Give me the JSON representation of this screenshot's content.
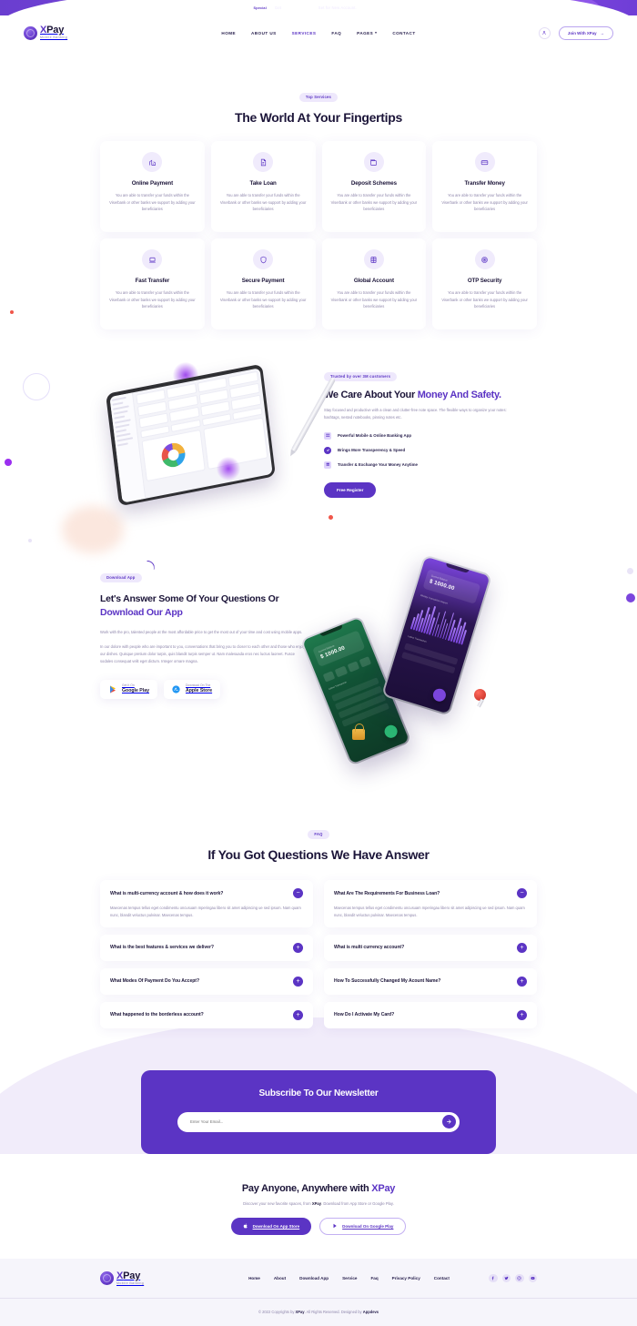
{
  "topbar": {
    "tag": "Special",
    "text_before": "Get",
    "highlight": "25 USD Bonus",
    "text_after": "Set for New Account.",
    "link": "Register Now"
  },
  "header": {
    "logo_x": "X",
    "logo_rest": "Pay",
    "logo_sub": "Mobile Banking",
    "nav": [
      {
        "label": "HOME",
        "active": false,
        "caret": ""
      },
      {
        "label": "ABOUT US",
        "active": false,
        "caret": ""
      },
      {
        "label": "SERVICES",
        "active": true,
        "caret": ""
      },
      {
        "label": "FAQ",
        "active": false,
        "caret": ""
      },
      {
        "label": "PAGES",
        "active": false,
        "caret": "▾"
      },
      {
        "label": "CONTACT",
        "active": false,
        "caret": ""
      }
    ],
    "join_label": "Join With XPay",
    "join_arrow": "→"
  },
  "services": {
    "pill": "Top Services",
    "title": "The World At Your Fingertips",
    "body": "You are able to transfer your funds within the Viserbank or other banks we support by adding your beneficiaries",
    "cards": [
      {
        "icon": "chart-building-icon",
        "title": "Online Payment"
      },
      {
        "icon": "loan-document-icon",
        "title": "Take Loan"
      },
      {
        "icon": "wallet-icon",
        "title": "Deposit Schemes"
      },
      {
        "icon": "card-icon",
        "title": "Transfer Money"
      },
      {
        "icon": "laptop-icon",
        "title": "Fast Transfer"
      },
      {
        "icon": "shield-icon",
        "title": "Secure Payment"
      },
      {
        "icon": "globe-grid-icon",
        "title": "Global Account"
      },
      {
        "icon": "fingerprint-icon",
        "title": "OTP Security"
      }
    ]
  },
  "care": {
    "pill": "Trusted by over 3M customers",
    "title_a": "We Care About Your ",
    "title_b": "Money And Safety.",
    "text": "Stay focused and productive with a clean and clutter-free note space. The flexible ways to organize your notes: hashtags, nested notebooks, pinning notes etc.",
    "features": [
      {
        "label": "Powerful Mobile & Online Banking App",
        "icon": "grid-icon"
      },
      {
        "label": "Brings More Transperency & Speed",
        "icon": "check-circle-icon"
      },
      {
        "label": "Transfer & Exchange Your Money Anytime",
        "icon": "layers-icon"
      }
    ],
    "button": "Free Register"
  },
  "download": {
    "pill": "Download App",
    "title_a": "Let's Answer Some Of Your Questions Or ",
    "title_b": "Download Our App",
    "p1": "Work with the pro, talented people at the most affordable price to get the most out of your time and cost using mobile apps.",
    "p2": "In our dolore with people who are important to you, conversations that bring you to closer to each other and those who enjoy our dishes. Quisque pretium dolor turpis, quis blandit turpis semper ut. Nam malesuada eros nec luctus laoreet. Fusce sodales consequat velit eget dictum. Integer ornare magna.",
    "stores": [
      {
        "icon": "google-play-icon",
        "small": "Get It On",
        "big": "Google Play"
      },
      {
        "icon": "apple-store-icon",
        "small": "Download On The",
        "big": "Apple Store"
      }
    ],
    "phone_balance_label": "Current Balance",
    "phone_balance": "$ 1000.00",
    "phone_chart_label": "Weekly Transaction Report",
    "phone_list_label": "Latest Transaction",
    "phone_bars": [
      40,
      55,
      72,
      48,
      86,
      64,
      95,
      58,
      78,
      42,
      88,
      66,
      52,
      92,
      70,
      46,
      82,
      60,
      74,
      50
    ]
  },
  "faq": {
    "pill": "FAQ",
    "title": "If You Got Questions We Have Answer",
    "answer": "Maecenas tempus tellus eget condimentu oncusuam mperingau libero sit amet adipiscing ue sed ipsum. Nam quam nunc, blandit veluctus pulvinar. Maecenas tempus.",
    "items": [
      {
        "q": "What is multi-currency account & how does it work?",
        "open": true,
        "toggle": "−"
      },
      {
        "q": "What Are The Requirements For Business Loan?",
        "open": true,
        "toggle": "−"
      },
      {
        "q": "What is the best features & services we deliver?",
        "open": false,
        "toggle": "+"
      },
      {
        "q": "What is multi currency account?",
        "open": false,
        "toggle": "+"
      },
      {
        "q": "What Modes Of Payment Do You Accept?",
        "open": false,
        "toggle": "+"
      },
      {
        "q": "How To Successfully Changed My Acount Name?",
        "open": false,
        "toggle": "+"
      },
      {
        "q": "What happened to the borderless account?",
        "open": false,
        "toggle": "+"
      },
      {
        "q": "How Do I Activate My Card?",
        "open": false,
        "toggle": "+"
      }
    ]
  },
  "newsletter": {
    "title": "Subscribe To Our Newsletter",
    "placeholder": "Enter Your Email...",
    "value": "",
    "submit_icon": "arrow-right-icon"
  },
  "cta": {
    "title_a": "Pay Anyone, Anywhere with ",
    "title_b": "XPay",
    "sub_a": "Discover your new favorite spaces, from ",
    "sub_b": "XPay",
    "sub_c": ". Download from App Store or Google Play.",
    "btn_apple": "Download On App Store",
    "btn_google": "Download On Google Play"
  },
  "footer": {
    "logo_x": "X",
    "logo_rest": "Pay",
    "logo_sub": "Mobile Banking",
    "nav": [
      "Home",
      "About",
      "Download App",
      "Service",
      "Faq",
      "Privacy Policy",
      "Contact"
    ],
    "socials": [
      "facebook-icon",
      "twitter-icon",
      "instagram-icon",
      "youtube-icon"
    ],
    "copyright_a": "© 2022 Copyrights by ",
    "copyright_b": "XPay",
    "copyright_c": ". All Rights Reserved. Designed by ",
    "copyright_d": "Appdevs"
  },
  "colors": {
    "accent": "#5b34c4",
    "accent_light": "#7b45dd",
    "text": "#1c1539",
    "muted": "#8e86ab",
    "footer_bg": "#f6f5fb"
  }
}
